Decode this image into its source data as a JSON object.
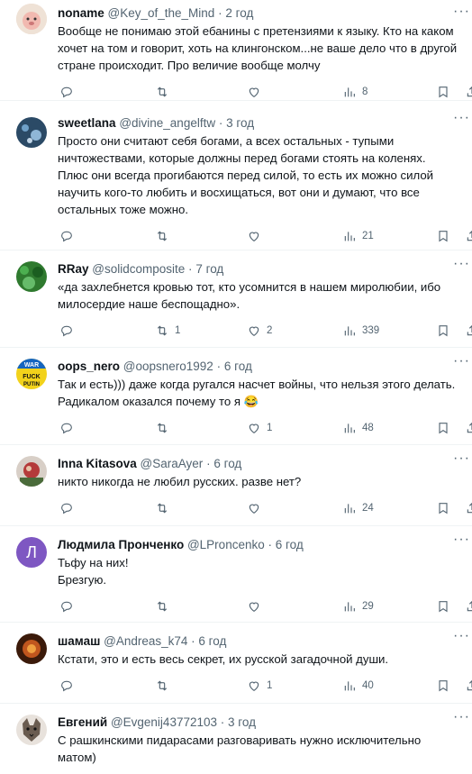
{
  "tweets": [
    {
      "name": "noname",
      "handle": "@Key_of_the_Mind",
      "time": "2 год",
      "text": "Вообще не понимаю этой ебанины с претензиями к языку. Кто на каком хочет на том и говорит, хоть на клингонском...не ваше дело что в другой стране происходит. Про величие вообще молчу",
      "replies": "",
      "retweets": "",
      "likes": "",
      "views": "8",
      "avatar_color": "#e9d7c9"
    },
    {
      "name": "sweetlana",
      "handle": "@divine_angelftw",
      "time": "3 год",
      "text": "Просто они считают себя богами, а всех остальных - тупыми ничтожествами, которые должны перед богами стоять на коленях. Плюс они всегда прогибаются перед силой, то есть их можно силой научить кого-то любить и восхищаться, вот они и думают, что все остальных тоже можно.",
      "replies": "",
      "retweets": "",
      "likes": "",
      "views": "21",
      "avatar_color": "#3a5a7a"
    },
    {
      "name": "RRay",
      "handle": "@solidcomposite",
      "time": "7 год",
      "text": "«да захлебнется кровью тот, кто усомнится в нашем миролюбии, ибо милосердие наше беспощадно».",
      "replies": "",
      "retweets": "1",
      "likes": "2",
      "views": "339",
      "avatar_color": "#2f7a2f"
    },
    {
      "name": "oops_nero",
      "handle": "@oopsnero1992",
      "time": "6 год",
      "text": "Так и есть))) даже когда ругался насчет войны, что нельзя этого делать. Радикалом оказался почему то я 😂",
      "replies": "",
      "retweets": "",
      "likes": "1",
      "views": "48",
      "avatar_color": "#f2d21b"
    },
    {
      "name": "Inna Kitasova",
      "handle": "@SaraAyer",
      "time": "6 год",
      "text": "никто никогда не любил русских. разве нет?",
      "replies": "",
      "retweets": "",
      "likes": "",
      "views": "24",
      "avatar_color": "#8a3030"
    },
    {
      "name": "Людмила Пронченко",
      "handle": "@LProncenko",
      "time": "6 год",
      "text": "Тьфу на них!\nБрезгую.",
      "replies": "",
      "retweets": "",
      "likes": "",
      "views": "29",
      "avatar_color": "#7e57c2",
      "avatar_letter": "Л"
    },
    {
      "name": "шамаш",
      "handle": "@Andreas_k74",
      "time": "6 год",
      "text": "Кстати, это и есть весь секрет, их русской загадочной души.",
      "replies": "",
      "retweets": "",
      "likes": "1",
      "views": "40",
      "avatar_color": "#6b2a12"
    },
    {
      "name": "Евгений",
      "handle": "@Evgenij43772103",
      "time": "3 год",
      "text": "С рашкинскими пидарасами разговаривать нужно исключительно матом)",
      "replies": "",
      "retweets": "",
      "likes": "",
      "views": "",
      "avatar_color": "#5a5046"
    }
  ]
}
